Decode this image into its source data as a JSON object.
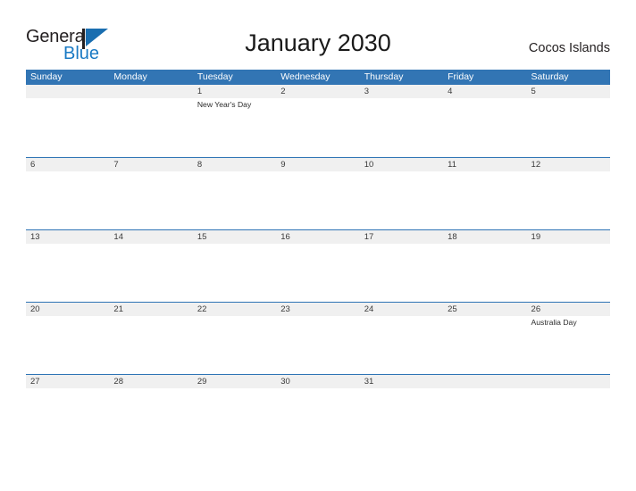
{
  "brand": {
    "line1": "General",
    "line2": "Blue",
    "flag_icon": "flag-triangle-icon",
    "accent_blue": "#1a7ac4"
  },
  "header": {
    "title": "January 2030",
    "region": "Cocos Islands"
  },
  "theme": {
    "header_blue": "#3275b4",
    "row_rule_blue": "#2e74b5",
    "band_gray": "#f0f0f0",
    "text_dark": "#231f20"
  },
  "calendar": {
    "weekdays": [
      "Sunday",
      "Monday",
      "Tuesday",
      "Wednesday",
      "Thursday",
      "Friday",
      "Saturday"
    ],
    "weeks": [
      [
        {
          "date": "",
          "events": []
        },
        {
          "date": "",
          "events": []
        },
        {
          "date": "1",
          "events": [
            "New Year's Day"
          ]
        },
        {
          "date": "2",
          "events": []
        },
        {
          "date": "3",
          "events": []
        },
        {
          "date": "4",
          "events": []
        },
        {
          "date": "5",
          "events": []
        }
      ],
      [
        {
          "date": "6",
          "events": []
        },
        {
          "date": "7",
          "events": []
        },
        {
          "date": "8",
          "events": []
        },
        {
          "date": "9",
          "events": []
        },
        {
          "date": "10",
          "events": []
        },
        {
          "date": "11",
          "events": []
        },
        {
          "date": "12",
          "events": []
        }
      ],
      [
        {
          "date": "13",
          "events": []
        },
        {
          "date": "14",
          "events": []
        },
        {
          "date": "15",
          "events": []
        },
        {
          "date": "16",
          "events": []
        },
        {
          "date": "17",
          "events": []
        },
        {
          "date": "18",
          "events": []
        },
        {
          "date": "19",
          "events": []
        }
      ],
      [
        {
          "date": "20",
          "events": []
        },
        {
          "date": "21",
          "events": []
        },
        {
          "date": "22",
          "events": []
        },
        {
          "date": "23",
          "events": []
        },
        {
          "date": "24",
          "events": []
        },
        {
          "date": "25",
          "events": []
        },
        {
          "date": "26",
          "events": [
            "Australia Day"
          ]
        }
      ],
      [
        {
          "date": "27",
          "events": []
        },
        {
          "date": "28",
          "events": []
        },
        {
          "date": "29",
          "events": []
        },
        {
          "date": "30",
          "events": []
        },
        {
          "date": "31",
          "events": []
        },
        {
          "date": "",
          "events": []
        },
        {
          "date": "",
          "events": []
        }
      ]
    ]
  }
}
